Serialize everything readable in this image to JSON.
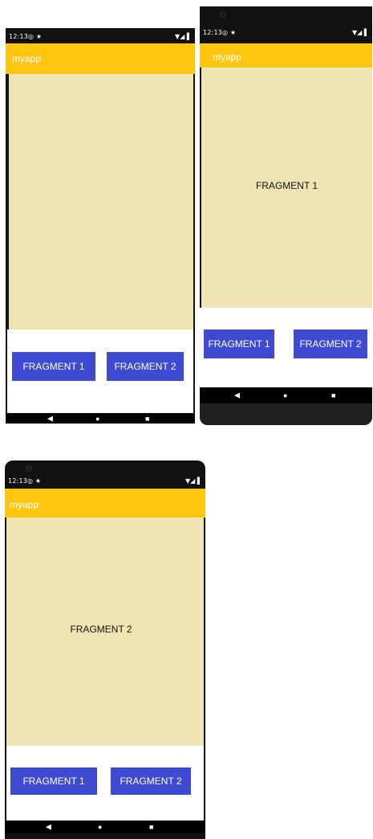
{
  "status": {
    "time": "12:13",
    "left_icons": "◎ ★",
    "right_icons": "▼◢ ▌"
  },
  "app": {
    "title": "myapp"
  },
  "buttons": {
    "fragment1": "FRAGMENT 1",
    "fragment2": "FRAGMENT 2"
  },
  "nav": {
    "back": "◀",
    "home": "●",
    "recents": "■"
  },
  "screens": [
    {
      "fragment_text": ""
    },
    {
      "fragment_text": "FRAGMENT 1"
    },
    {
      "fragment_text": "FRAGMENT 2"
    }
  ],
  "colors": {
    "appbar": "#FFC50F",
    "content": "#EEE4B4",
    "button": "#3E4BD1"
  }
}
